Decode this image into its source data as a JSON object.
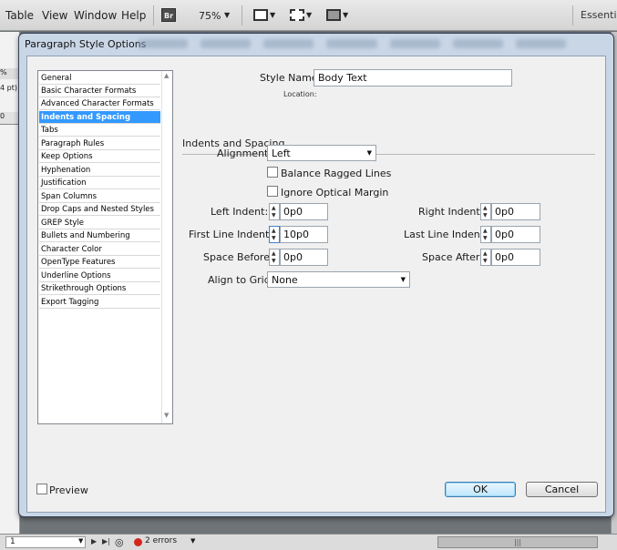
{
  "menubar": {
    "items": [
      "Table",
      "View",
      "Window",
      "Help"
    ],
    "bridge_button": "Br",
    "zoom": "75%",
    "workspace": "Essentials"
  },
  "doc": {
    "zoom_stub": "%",
    "pt_stub": "4 pt)",
    "ruler_stub": "0"
  },
  "dialog": {
    "title": "Paragraph Style Options",
    "categories": [
      "General",
      "Basic Character Formats",
      "Advanced Character Formats",
      "Indents and Spacing",
      "Tabs",
      "Paragraph Rules",
      "Keep Options",
      "Hyphenation",
      "Justification",
      "Span Columns",
      "Drop Caps and Nested Styles",
      "GREP Style",
      "Bullets and Numbering",
      "Character Color",
      "OpenType Features",
      "Underline Options",
      "Strikethrough Options",
      "Export Tagging"
    ],
    "selected_category": "Indents and Spacing",
    "style_name_label": "Style Name:",
    "style_name_value": "Body Text",
    "location_label": "Location:",
    "section_title": "Indents and Spacing",
    "alignment": {
      "label": "Alignment:",
      "value": "Left"
    },
    "balance_ragged": {
      "label": "Balance Ragged Lines",
      "checked": false
    },
    "ignore_optical": {
      "label": "Ignore Optical Margin",
      "checked": false
    },
    "left_indent": {
      "label": "Left Indent:",
      "value": "0p0"
    },
    "right_indent": {
      "label": "Right Indent:",
      "value": "0p0"
    },
    "first_line_indent": {
      "label": "First Line Indent:",
      "value": "10p0"
    },
    "last_line_indent": {
      "label": "Last Line Indent:",
      "value": "0p0"
    },
    "space_before": {
      "label": "Space Before:",
      "value": "0p0"
    },
    "space_after": {
      "label": "Space After:",
      "value": "0p0"
    },
    "align_to_grid": {
      "label": "Align to Grid:",
      "value": "None"
    },
    "preview": {
      "label": "Preview",
      "checked": false
    },
    "ok_label": "OK",
    "cancel_label": "Cancel"
  },
  "statusbar": {
    "page": "1",
    "errors": "2 errors"
  },
  "colors": {
    "selection": "#3399ff",
    "error": "#d4261e",
    "dialog_frame": "#c9d6e6"
  }
}
